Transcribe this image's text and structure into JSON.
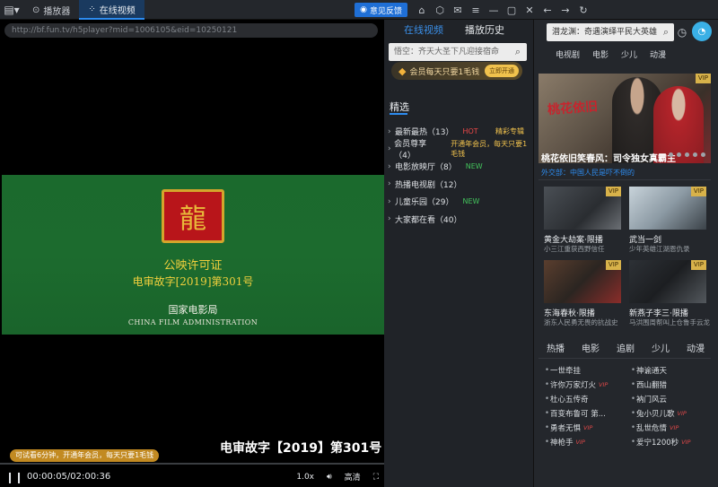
{
  "titlebar": {
    "tabs": [
      {
        "label": "播放器",
        "icon": "play-circle-icon"
      },
      {
        "label": "在线视频",
        "icon": "grid-icon"
      }
    ],
    "feedback_label": "意见反馈"
  },
  "player": {
    "url": "http://bf.fun.tv/h5player?mid=1006105&eid=10250121",
    "cert_line1": "公映许可证",
    "cert_line2": "电审故字[2019]第301号",
    "cert_line3": "国家电影局",
    "cert_line4": "CHINA FILM ADMINISTRATION",
    "subtitle": "电审故字【2019】第301号",
    "trial_notice": "可试看6分钟，开通年会员，每天只要1毛钱",
    "time": "00:00:05/02:00:36",
    "speed": "1.0x",
    "quality": "高清"
  },
  "mid": {
    "tabs": [
      "在线视频",
      "播放历史"
    ],
    "search_placeholder": "悟空：齐天大圣下凡迎接宿命",
    "vip_text": "会员每天只要1毛钱",
    "vip_button": "立即开通",
    "section_title": "精选",
    "categories": [
      {
        "label": "最新最热（13）",
        "badge": "HOT",
        "badge_type": "hot",
        "extra": "精彩专辑"
      },
      {
        "label": "会员尊享（4）",
        "badge": "开通年会员，每天只要1毛钱",
        "badge_type": "promo",
        "extra": ""
      },
      {
        "label": "电影放映厅（8）",
        "badge": "NEW",
        "badge_type": "new",
        "extra": ""
      },
      {
        "label": "热播电视剧（12）",
        "badge": "",
        "badge_type": "",
        "extra": ""
      },
      {
        "label": "儿童乐园（29）",
        "badge": "NEW",
        "badge_type": "new",
        "extra": ""
      },
      {
        "label": "大家都在看（40）",
        "badge": "",
        "badge_type": "",
        "extra": ""
      }
    ]
  },
  "right": {
    "search_value": "潜龙渊：奇遇演绎平民大英雄",
    "nav": [
      "电视剧",
      "电影",
      "少儿",
      "动漫"
    ],
    "hero_caption": "桃花依旧笑春风：司令独女真霸主",
    "hero_sub": "外交部：中国人民是吓不倒的",
    "vip_tag": "VIP",
    "thumbs": [
      {
        "title": "黄金大劫案·限播",
        "desc": "小三江重获西野信任"
      },
      {
        "title": "武当一剑",
        "desc": "少年英雄江湖恩仇录"
      },
      {
        "title": "东海春秋·限播",
        "desc": "浙东人民勇无畏的抗战史"
      },
      {
        "title": "新燕子李三·限播",
        "desc": "马洪围周帮叫上仓鲁手云龙"
      }
    ],
    "tabs": [
      "热播",
      "电影",
      "追剧",
      "少儿",
      "动漫"
    ],
    "rank_left": [
      {
        "name": "一世牵挂",
        "vip": ""
      },
      {
        "name": "许你万家灯火",
        "vip": "VIP"
      },
      {
        "name": "杜心五传奇",
        "vip": ""
      },
      {
        "name": "百变布鲁可 第...",
        "vip": ""
      },
      {
        "name": "勇者无惧",
        "vip": "VIP"
      },
      {
        "name": "神枪手",
        "vip": "VIP"
      }
    ],
    "rank_right": [
      {
        "name": "神谕通天",
        "vip": ""
      },
      {
        "name": "西山翻猎",
        "vip": ""
      },
      {
        "name": "衲门风云",
        "vip": ""
      },
      {
        "name": "兔小贝儿歌",
        "vip": "VIP"
      },
      {
        "name": "乱世危情",
        "vip": "VIP"
      },
      {
        "name": "爱宁1200秒",
        "vip": "VIP"
      }
    ]
  }
}
